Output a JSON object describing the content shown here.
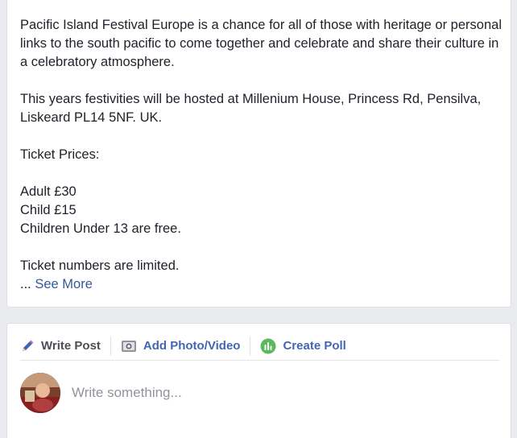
{
  "about": {
    "paragraph1": "Pacific Island Festival Europe is a chance for all of those with heritage or personal links to the south pacific to come together and celebrate and share their culture in a celebratory atmosphere.",
    "paragraph2": "This years festivities will be hosted at Millenium House, Princess Rd, Pensilva, Liskeard PL14 5NF. UK.",
    "ticket_heading": "Ticket Prices:",
    "price_adult": "Adult £30",
    "price_child": "Child £15",
    "price_under13": "Children Under 13 are free.",
    "limited_note": "Ticket numbers are limited.",
    "ellipsis": "...",
    "see_more": "See More"
  },
  "composer": {
    "tabs": [
      {
        "label": "Write Post",
        "icon": "pencil-icon"
      },
      {
        "label": "Add Photo/Video",
        "icon": "camera-icon"
      },
      {
        "label": "Create Poll",
        "icon": "poll-icon"
      }
    ],
    "placeholder": "Write something..."
  },
  "colors": {
    "link": "#365899",
    "tab_link": "#4267b2",
    "poll_green": "#5cb85c",
    "pencil_blue": "#4267b2"
  }
}
